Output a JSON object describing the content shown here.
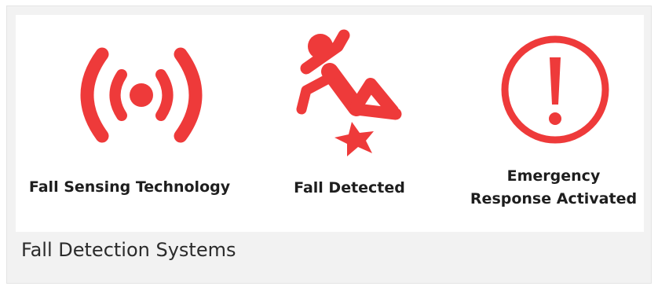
{
  "figure": {
    "items": [
      {
        "icon": "signal-broadcast-icon",
        "label": "Fall Sensing Technology"
      },
      {
        "icon": "person-falling-icon",
        "label": "Fall Detected"
      },
      {
        "icon": "exclamation-circle-icon",
        "label_line1": "Emergency",
        "label_line2": "Response Activated"
      }
    ],
    "caption": "Fall Detection Systems"
  },
  "colors": {
    "icon_red": "#ee3a3a",
    "label_text": "#1e1e1e",
    "frame_bg": "#f2f2f2"
  }
}
